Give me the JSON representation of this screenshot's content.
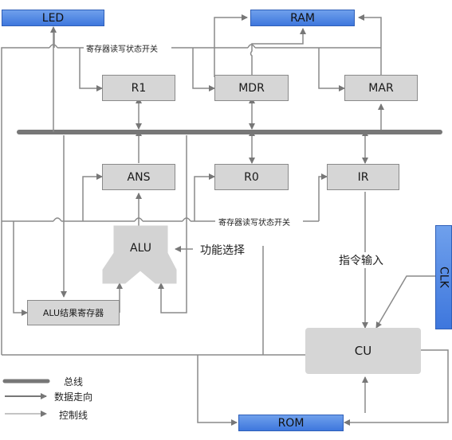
{
  "nodes": {
    "led": "LED",
    "ram": "RAM",
    "r1": "R1",
    "mdr": "MDR",
    "mar": "MAR",
    "ans": "ANS",
    "r0": "R0",
    "ir": "IR",
    "alu": "ALU",
    "alu_result_reg": "ALU结果寄存器",
    "cu": "CU",
    "rom": "ROM",
    "clk": "CLK"
  },
  "labels": {
    "reg_rw_switch_top": "寄存器读写状态开关",
    "reg_rw_switch_bottom": "寄存器读写状态开关",
    "func_select": "功能选择",
    "instr_input": "指令输入"
  },
  "legend": {
    "bus": "总线",
    "data_flow": "数据走向",
    "control_line": "控制线"
  },
  "colors": {
    "bus": "#777777",
    "wire": "#8a8a8a",
    "register_fill": "#d6d6d6",
    "io_fill": "#4f86e6"
  }
}
